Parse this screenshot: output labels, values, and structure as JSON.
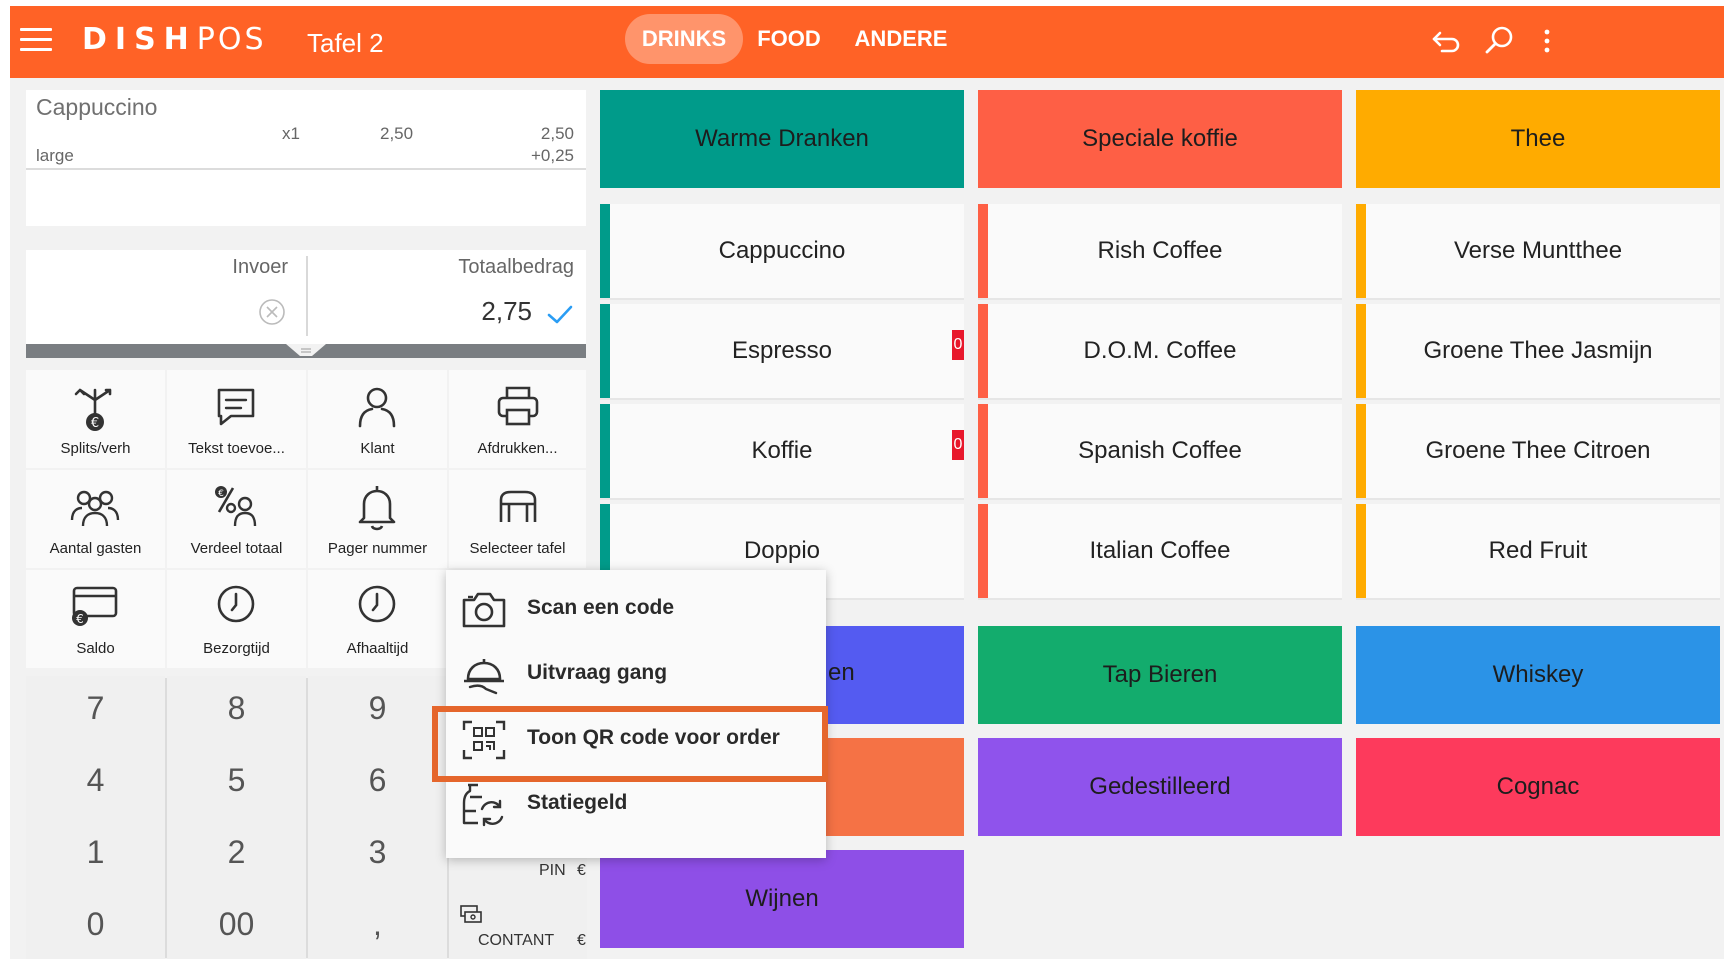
{
  "brand": {
    "dish": "DISH",
    "pos": "POS"
  },
  "header": {
    "table": "Tafel 2",
    "tabs": [
      {
        "label": "DRINKS",
        "active": true
      },
      {
        "label": "FOOD",
        "active": false
      },
      {
        "label": "ANDERE",
        "active": false
      }
    ]
  },
  "order": {
    "item": "Cappuccino",
    "qty": "x1",
    "unit_price": "2,50",
    "line_total": "2,50",
    "modifier": "large",
    "modifier_price": "+0,25"
  },
  "entry": {
    "invoer_label": "Invoer",
    "total_label": "Totaalbedrag",
    "total_value": "2,75"
  },
  "functions": [
    {
      "label": "Splits/verh",
      "icon": "split-euro-icon"
    },
    {
      "label": "Tekst toevoe...",
      "icon": "message-icon"
    },
    {
      "label": "Klant",
      "icon": "person-icon"
    },
    {
      "label": "Afdrukken...",
      "icon": "printer-icon"
    },
    {
      "label": "Aantal gasten",
      "icon": "guests-icon"
    },
    {
      "label": "Verdeel totaal",
      "icon": "percent-person-icon"
    },
    {
      "label": "Pager nummer",
      "icon": "bell-icon"
    },
    {
      "label": "Selecteer tafel",
      "icon": "table-icon"
    },
    {
      "label": "Saldo",
      "icon": "card-euro-icon"
    },
    {
      "label": "Bezorgtijd",
      "icon": "clock-icon"
    },
    {
      "label": "Afhaaltijd",
      "icon": "clock-icon"
    }
  ],
  "numpad": [
    "7",
    "8",
    "9",
    "4",
    "5",
    "6",
    "1",
    "2",
    "3",
    "0",
    "00",
    ","
  ],
  "payment": {
    "pin": "PIN",
    "cash": "CONTANT",
    "currency": "€"
  },
  "categories_top": [
    "Warme Dranken",
    "Speciale koffie",
    "Thee"
  ],
  "columns": {
    "warme": [
      "Cappuccino",
      "Espresso",
      "Koffie",
      "Doppio"
    ],
    "speciale": [
      "Rish Coffee",
      "D.O.M. Coffee",
      "Spanish Coffee",
      "Italian Coffee"
    ],
    "thee": [
      "Verse Muntthee",
      "Groene Thee Jasmijn",
      "Groene Thee Citroen",
      "Red Fruit"
    ]
  },
  "badges": [
    "0",
    "0"
  ],
  "categories_bottom": {
    "hidden_partial": "en",
    "tap": "Tap Bieren",
    "whiskey": "Whiskey",
    "gedestilleerd": "Gedestilleerd",
    "cognac": "Cognac",
    "wijnen": "Wijnen"
  },
  "popup_menu": [
    {
      "label": "Scan een code",
      "icon": "camera-icon"
    },
    {
      "label": "Uitvraag gang",
      "icon": "serving-cloche-icon"
    },
    {
      "label": "Toon QR code voor order",
      "icon": "qr-code-icon",
      "highlighted": true
    },
    {
      "label": "Statiegeld",
      "icon": "bottle-refund-icon"
    }
  ],
  "colors": {
    "topbar": "#ff6226",
    "warme": "#009b8a",
    "speciale": "#fe5f45",
    "thee": "#ffab00",
    "blue_purple": "#545bf1",
    "tap": "#13ac6d",
    "whiskey": "#2b93e7",
    "orange_tile": "#f57245",
    "gedestilleerd": "#8f53ec",
    "cognac": "#fd3a5c",
    "wijnen": "#8e4fe7",
    "highlight": "#e5662c"
  }
}
